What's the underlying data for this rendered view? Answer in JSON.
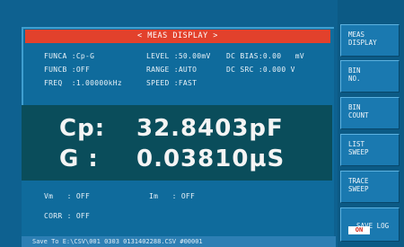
{
  "title": "< MEAS DISPLAY >",
  "params": {
    "funca": "FUNCA :Cp-G",
    "level": "LEVEL :50.00mV",
    "dc_bias": "DC BIAS:0.00   mV",
    "funcb": "FUNCB :OFF",
    "range": "RANGE :AUTO",
    "dc_src": "DC SRC :0.000 V",
    "freq": "FREQ  :1.00000kHz",
    "speed": "SPEED :FAST"
  },
  "readout": {
    "primary_label": "Cp:",
    "primary_value": "32.8403pF",
    "secondary_label": "G :",
    "secondary_value": "0.03810µS"
  },
  "monitor": {
    "vm": "Vm   : OFF",
    "im": "Im   : OFF",
    "corr": "CORR : OFF"
  },
  "status": "Save To E:\\CSV\\001 0303 0131402288.CSV #00001",
  "softkeys": [
    "MEAS\nDISPLAY",
    "BIN\nNO.",
    "BIN\nCOUNT",
    "LIST\nSWEEP",
    "TRACE\nSWEEP",
    "SAVE LOG"
  ],
  "save_log_state": "ON",
  "colors": {
    "background": "#0e6190",
    "title_bar": "#e2412c",
    "readout_bg": "#0a4d5b",
    "softkey": "#1a79b0"
  }
}
